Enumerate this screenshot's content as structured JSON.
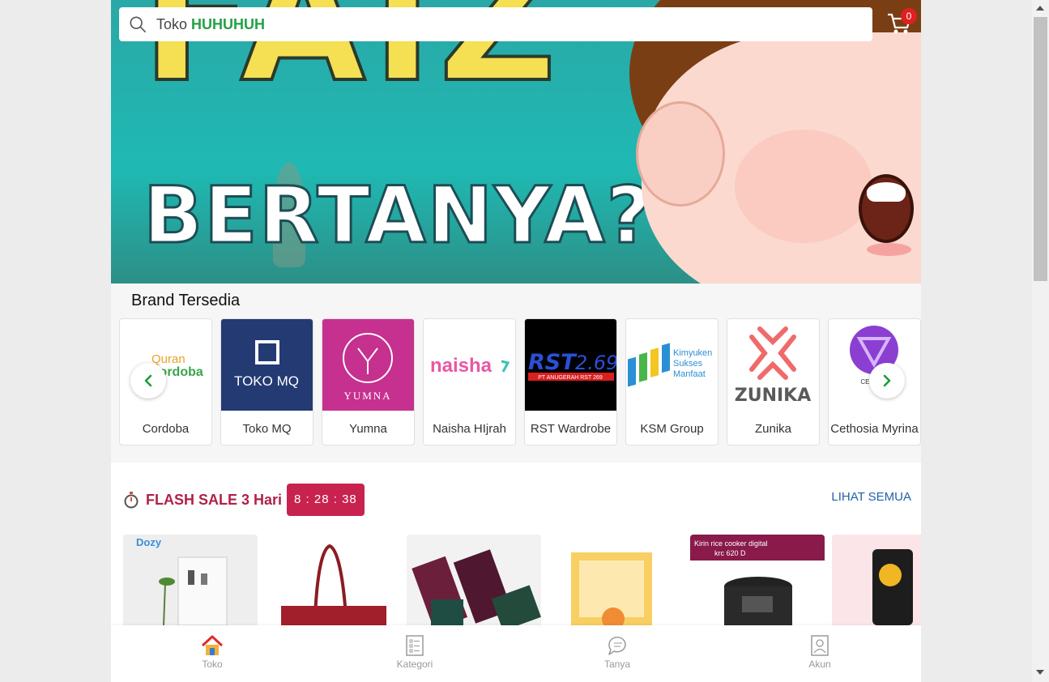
{
  "search": {
    "prefix": "Toko",
    "store_name": "HUHUHUH"
  },
  "cart": {
    "count": "0"
  },
  "banner": {
    "title_line1": "FAIZ",
    "title_line2": "BERTANYA?"
  },
  "brands": {
    "title": "Brand Tersedia",
    "items": [
      {
        "name": "Cordoba",
        "logo_text": "Quran Cordoba"
      },
      {
        "name": "Toko MQ",
        "logo_text": "TOKO MQ"
      },
      {
        "name": "Yumna",
        "logo_text": "YUMNA"
      },
      {
        "name": "Naisha HIjrah",
        "logo_text": "naisha"
      },
      {
        "name": "RST Wardrobe",
        "logo_text": "RST 2.69",
        "logo_sub": "PT ANUGERAH RST 269"
      },
      {
        "name": "KSM Group",
        "logo_text": "Kimyuken Sukses Manfaat"
      },
      {
        "name": "Zunika",
        "logo_text": "ZUNIKA"
      },
      {
        "name": "Cethosia Myrina",
        "logo_text": "CETHOS"
      }
    ]
  },
  "flash_sale": {
    "title": "FLASH SALE 3 Hari",
    "timer": "8 : 28 : 38",
    "see_all": "LIHAT SEMUA",
    "products": [
      {
        "label": "Dozy"
      },
      {
        "label": ""
      },
      {
        "label": ""
      },
      {
        "label": ""
      },
      {
        "label": "Kirin rice cooker digital krc 620 D"
      },
      {
        "label": ""
      }
    ]
  },
  "bottom_nav": [
    {
      "label": "Toko",
      "icon": "home-icon"
    },
    {
      "label": "Kategori",
      "icon": "list-icon"
    },
    {
      "label": "Tanya",
      "icon": "chat-icon"
    },
    {
      "label": "Akun",
      "icon": "account-icon"
    }
  ],
  "colors": {
    "accent_green": "#24a148",
    "flash_red": "#c8224f",
    "link_blue": "#2460a7"
  }
}
